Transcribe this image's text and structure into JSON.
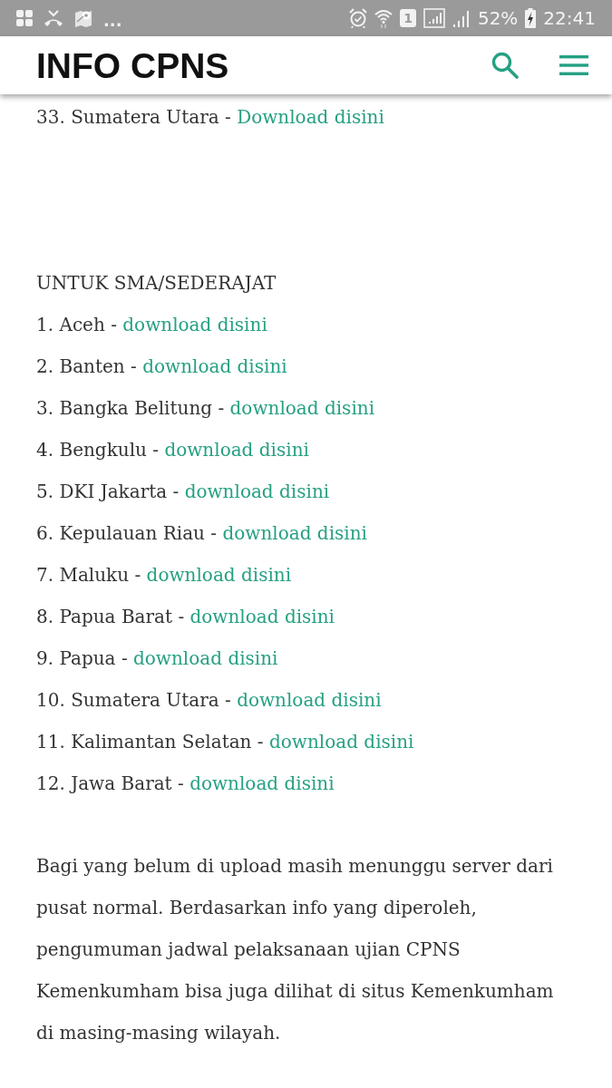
{
  "status_bar": {
    "overflow": "...",
    "sim_slot": "1",
    "battery": "52%",
    "time": "22:41"
  },
  "header": {
    "title": "INFO CPNS"
  },
  "article": {
    "previous_item": {
      "label": "33. Sumatera Utara - ",
      "link": "Download disini"
    },
    "section_title": "UNTUK SMA/SEDERAJAT",
    "items": [
      {
        "label": "1. Aceh - ",
        "link": "download disini"
      },
      {
        "label": "2. Banten - ",
        "link": "download disini"
      },
      {
        "label": "3. Bangka Belitung - ",
        "link": "download disini"
      },
      {
        "label": "4. Bengkulu - ",
        "link": "download disini"
      },
      {
        "label": "5. DKI Jakarta - ",
        "link": "download disini"
      },
      {
        "label": "6. Kepulauan Riau - ",
        "link": "download disini"
      },
      {
        "label": "7. Maluku - ",
        "link": "download disini"
      },
      {
        "label": "8. Papua Barat - ",
        "link": "download disini"
      },
      {
        "label": "9. Papua - ",
        "link": "download disini"
      },
      {
        "label": "10. Sumatera Utara - ",
        "link": "download disini"
      },
      {
        "label": "11. Kalimantan Selatan - ",
        "link": "download disini"
      },
      {
        "label": "12. Jawa Barat - ",
        "link": "download disini"
      }
    ],
    "paragraph": "Bagi yang belum di upload masih menunggu server dari pusat normal. Berdasarkan info yang diperoleh, pengumuman jadwal pelaksanaan ujian CPNS Kemenkumham bisa juga dilihat di situs Kemenkumham di masing-masing wilayah."
  }
}
